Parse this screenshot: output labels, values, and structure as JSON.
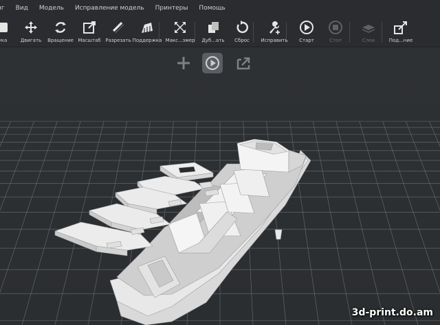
{
  "menu": {
    "items": [
      "нг",
      "Вид",
      "Модель",
      "Исправление модель",
      "Принтеры",
      "Помощь"
    ]
  },
  "toolbar": {
    "tools": [
      {
        "label": "ука",
        "icon": "load-icon",
        "enabled": true
      },
      {
        "label": "Двигать",
        "icon": "move-icon",
        "enabled": true
      },
      {
        "label": "Вращение",
        "icon": "rotate-icon",
        "enabled": true
      },
      {
        "label": "Масштаб",
        "icon": "scale-icon",
        "enabled": true
      },
      {
        "label": "Разрезать",
        "icon": "cut-icon",
        "enabled": true
      },
      {
        "label": "Поддержка",
        "icon": "support-icon",
        "enabled": true
      },
      {
        "label": "Макс...змер",
        "icon": "maximize-icon",
        "enabled": true
      },
      {
        "label": "Дуб...ать",
        "icon": "duplicate-icon",
        "enabled": true
      },
      {
        "label": "Сброс",
        "icon": "reset-icon",
        "enabled": true
      },
      {
        "label": "Исправить",
        "icon": "repair-icon",
        "enabled": true
      },
      {
        "label": "Старт",
        "icon": "play-icon",
        "enabled": true
      },
      {
        "label": "Стоп",
        "icon": "stop-icon",
        "enabled": false
      },
      {
        "label": "Слои",
        "icon": "layers-icon",
        "enabled": false
      },
      {
        "label": "Под...ние",
        "icon": "connect-icon",
        "enabled": true
      }
    ]
  },
  "viewport": {
    "buttons": [
      {
        "icon": "add-icon",
        "active": false
      },
      {
        "icon": "play-circle-icon",
        "active": true
      },
      {
        "icon": "export-icon",
        "active": false
      }
    ],
    "model": "ship-model"
  },
  "watermark": "3d-print.do.am",
  "colors": {
    "background": "#2d3033",
    "toolbar": "#2a2c2f",
    "grid": "#6b6f73",
    "model": "#e6e6e6"
  }
}
